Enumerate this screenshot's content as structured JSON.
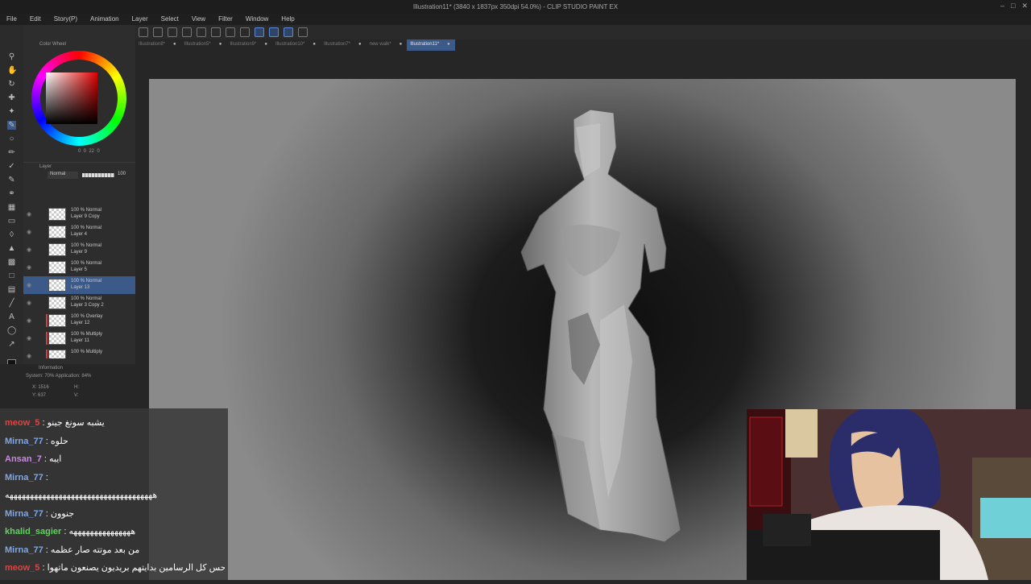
{
  "window": {
    "title": "Illustration11* (3840 x 1837px 350dpi 54.0%) - CLIP STUDIO PAINT EX"
  },
  "menu": [
    "File",
    "Edit",
    "Story(P)",
    "Animation",
    "Layer",
    "Select",
    "View",
    "Filter",
    "Window",
    "Help"
  ],
  "tabs": [
    {
      "label": "Illustration8*",
      "active": false
    },
    {
      "label": "Illustration5*",
      "active": false
    },
    {
      "label": "Illustration9*",
      "active": false
    },
    {
      "label": "Illustration10*",
      "active": false
    },
    {
      "label": "Illustration7*",
      "active": false
    },
    {
      "label": "new walk*",
      "active": false
    },
    {
      "label": "Illustration11*",
      "active": true
    }
  ],
  "color_panel": {
    "title": "Color Wheel",
    "values": "0  0  22  0"
  },
  "layer_panel": {
    "tab_label": "Layer",
    "blend_mode": "Normal",
    "opacity": "100",
    "layers": [
      {
        "line1": "100 % Normal",
        "line2": "Layer 9 Copy",
        "selected": false,
        "red": false
      },
      {
        "line1": "100 % Normal",
        "line2": "Layer 4",
        "selected": false,
        "red": false
      },
      {
        "line1": "100 % Normal",
        "line2": "Layer 9",
        "selected": false,
        "red": false
      },
      {
        "line1": "100 % Normal",
        "line2": "Layer 5",
        "selected": false,
        "red": false
      },
      {
        "line1": "100 % Normal",
        "line2": "Layer 13",
        "selected": true,
        "red": false
      },
      {
        "line1": "100 % Normal",
        "line2": "Layer 3 Copy 2",
        "selected": false,
        "red": false
      },
      {
        "line1": "100 % Overlay",
        "line2": "Layer 12",
        "selected": false,
        "red": true
      },
      {
        "line1": "100 % Multiply",
        "line2": "Layer 11",
        "selected": false,
        "red": true
      },
      {
        "line1": "100 % Multiply",
        "line2": "",
        "selected": false,
        "red": true
      }
    ]
  },
  "info_panel": {
    "tab_label": "Information",
    "system": "System: 70%  Application: 84%",
    "x": "X: 1516",
    "y": "Y: 637",
    "h": "H:",
    "v": "V:"
  },
  "chat": [
    {
      "user": "meow_5",
      "sep": " : ",
      "msg": "يشبه سونغ جينو",
      "color": "#e0433d"
    },
    {
      "user": "Mirna_77",
      "sep": " : ",
      "msg": "حلوه",
      "color": "#7fa7e8"
    },
    {
      "user": "Ansan_7",
      "sep": " : ",
      "msg": "ايبه",
      "color": "#c88ae0"
    },
    {
      "user": "Mirna_77",
      "sep": " : ",
      "msg": "",
      "color": "#7fa7e8"
    },
    {
      "user": "",
      "sep": "",
      "msg": "ههههههههههههههههههههههههههههههههههههه",
      "color": "#ffffff"
    },
    {
      "user": "Mirna_77",
      "sep": " : ",
      "msg": "جنوون",
      "color": "#7fa7e8"
    },
    {
      "user": "khalid_sagier",
      "sep": " : ",
      "msg": "هههههههههههههههه",
      "color": "#5fd35f"
    },
    {
      "user": "Mirna_77",
      "sep": " : ",
      "msg": "من بعد موتته صار عظمه",
      "color": "#7fa7e8"
    },
    {
      "user": "meow_5",
      "sep": " : ",
      "msg": "احس كل الرسامين بدايتهم بريديون يصنعون ماتهوا",
      "color": "#e0433d"
    }
  ],
  "colors": {
    "accent": "#3b5a8a",
    "panel_bg": "#2d2d2d",
    "canvas_light": "#8a8a8a",
    "canvas_dark": "#0e0e0e"
  }
}
